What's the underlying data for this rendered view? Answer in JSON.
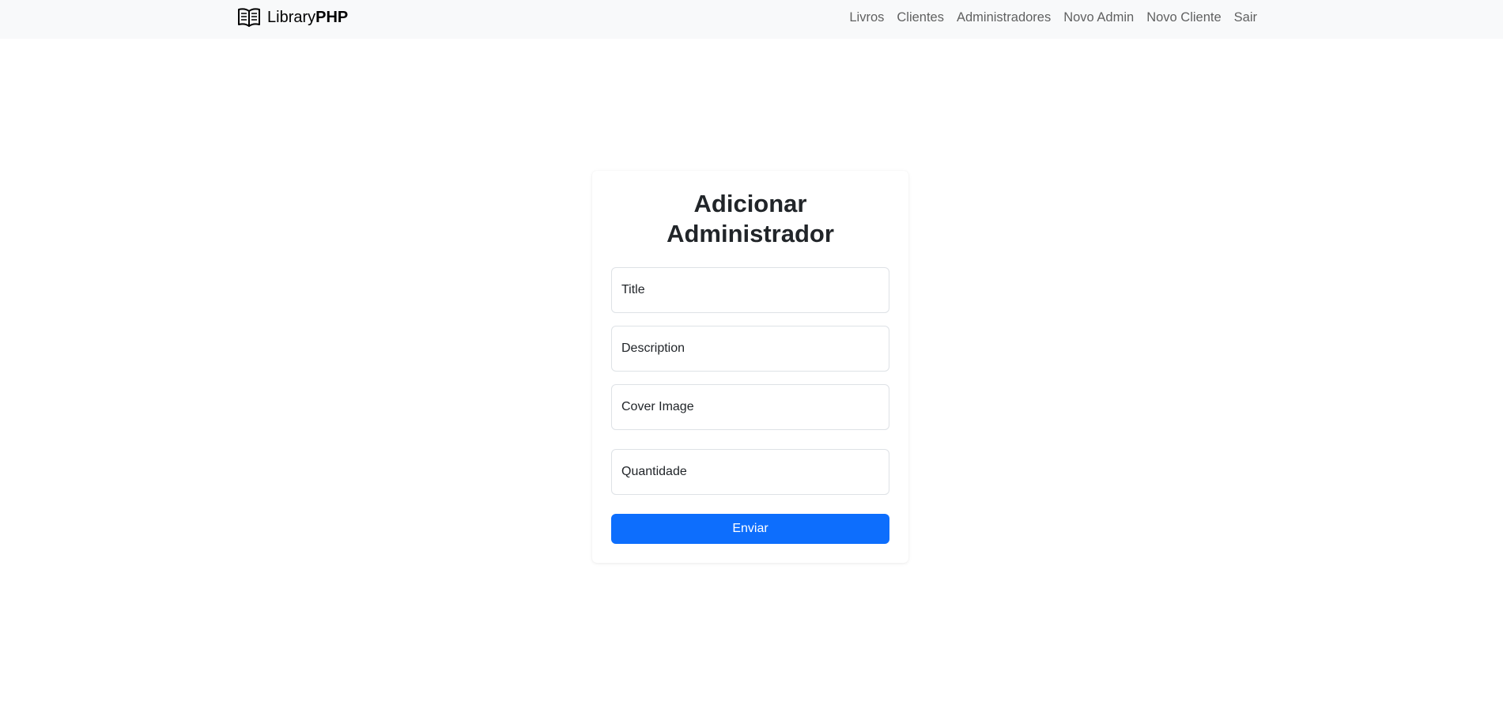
{
  "navbar": {
    "brand_icon": "open-book-icon",
    "brand_prefix": "Library",
    "brand_suffix": "PHP",
    "links": [
      "Livros",
      "Clientes",
      "Administradores",
      "Novo Admin",
      "Novo Cliente",
      "Sair"
    ]
  },
  "form": {
    "title_line1": "Adicionar",
    "title_line2": "Administrador",
    "fields": [
      {
        "placeholder": "Title"
      },
      {
        "placeholder": "Description"
      },
      {
        "placeholder": "Cover Image"
      },
      {
        "placeholder": "Quantidade"
      }
    ],
    "submit_label": "Enviar"
  },
  "colors": {
    "navbar_bg": "#f8f9fa",
    "primary": "#0d6efd",
    "text": "#212529"
  }
}
